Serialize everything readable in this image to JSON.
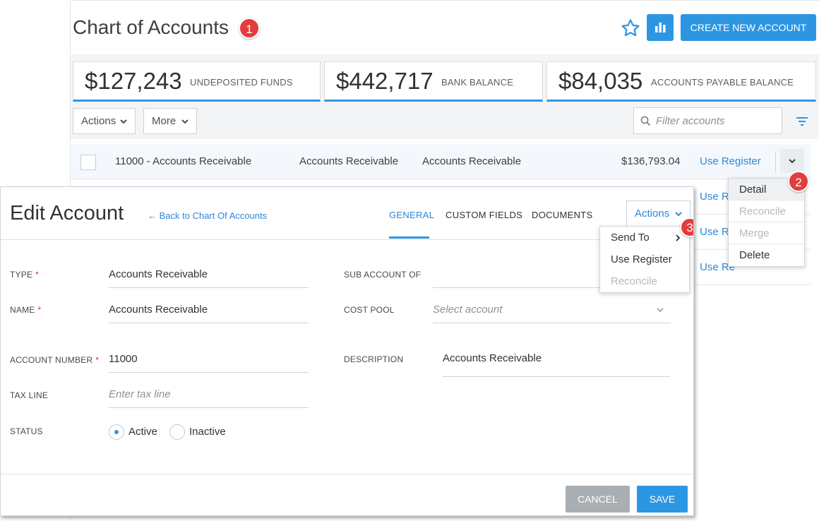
{
  "coa": {
    "title": "Chart of Accounts",
    "badge1": "1",
    "create_label": "CREATE NEW ACCOUNT",
    "kpis": [
      {
        "amount": "$127,243",
        "label": "UNDEPOSITED FUNDS"
      },
      {
        "amount": "$442,717",
        "label": "BANK BALANCE"
      },
      {
        "amount": "$84,035",
        "label": "ACCOUNTS PAYABLE BALANCE"
      }
    ],
    "actions_label": "Actions",
    "more_label": "More",
    "filter_placeholder": "Filter accounts",
    "row": {
      "name": "11000 - Accounts Receivable",
      "type": "Accounts Receivable",
      "subtype": "Accounts Receivable",
      "balance": "$136,793.04",
      "use_register": "Use Register"
    },
    "row_link_truncated": "Use Re",
    "row_menu": {
      "badge": "2",
      "items": [
        "Detail",
        "Reconcile",
        "Merge",
        "Delete"
      ]
    },
    "colors": {
      "accent": "#2d96e3",
      "badge": "#e23c3c"
    }
  },
  "edit": {
    "title": "Edit Account",
    "back_link": "← Back to Chart Of Accounts",
    "tabs": [
      "GENERAL",
      "CUSTOM FIELDS",
      "DOCUMENTS"
    ],
    "actions_label": "Actions",
    "actions_menu": {
      "badge": "3",
      "items": [
        "Send To",
        "Use Register",
        "Reconcile"
      ]
    },
    "fields": {
      "type_label": "TYPE",
      "type_value": "Accounts Receivable",
      "name_label": "NAME",
      "name_value": "Accounts Receivable",
      "account_number_label": "ACCOUNT NUMBER",
      "account_number_value": "11000",
      "tax_line_label": "TAX LINE",
      "tax_line_placeholder": "Enter tax line",
      "status_label": "STATUS",
      "status_active": "Active",
      "status_inactive": "Inactive",
      "sub_account_label": "SUB ACCOUNT OF",
      "cost_pool_label": "COST POOL",
      "cost_pool_placeholder": "Select account",
      "description_label": "DESCRIPTION",
      "description_value": "Accounts Receivable"
    },
    "required_mark": "*",
    "cancel_label": "CANCEL",
    "save_label": "SAVE"
  }
}
